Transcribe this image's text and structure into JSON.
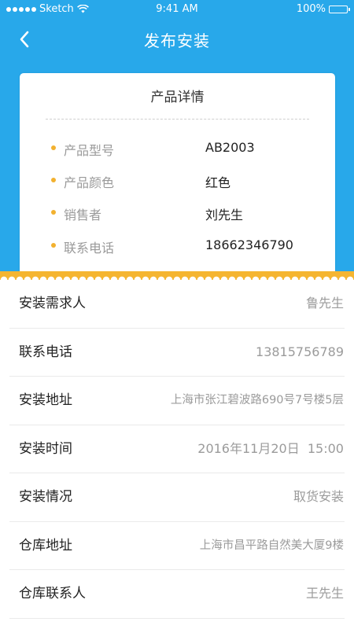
{
  "status_bar": {
    "carrier": "Sketch",
    "time": "9:41 AM",
    "battery": "100%"
  },
  "nav": {
    "title": "发布安装",
    "back_icon": "chevron-left-icon"
  },
  "product_card": {
    "title": "产品详情",
    "rows": [
      {
        "label": "产品型号",
        "value": "AB2003"
      },
      {
        "label": "产品颜色",
        "value": "红色"
      },
      {
        "label": "销售者",
        "value": "刘先生"
      },
      {
        "label": "联系电话",
        "value": "18662346790"
      }
    ]
  },
  "form": {
    "rows": [
      {
        "label": "安装需求人",
        "value": "鲁先生"
      },
      {
        "label": "联系电话",
        "value": "13815756789"
      },
      {
        "label": "安装地址",
        "value": "上海市张江碧波路690号7号楼5层"
      },
      {
        "label": "安装时间",
        "value": "2016年11月20日  15:00"
      },
      {
        "label": "安装情况",
        "value": "取货安装"
      },
      {
        "label": "仓库地址",
        "value": "上海市昌平路自然美大厦9楼"
      },
      {
        "label": "仓库联系人",
        "value": "王先生"
      }
    ]
  },
  "colors": {
    "header_blue": "#28a8ea",
    "accent_orange": "#f5b530",
    "bullet_orange": "#f2b12f"
  }
}
